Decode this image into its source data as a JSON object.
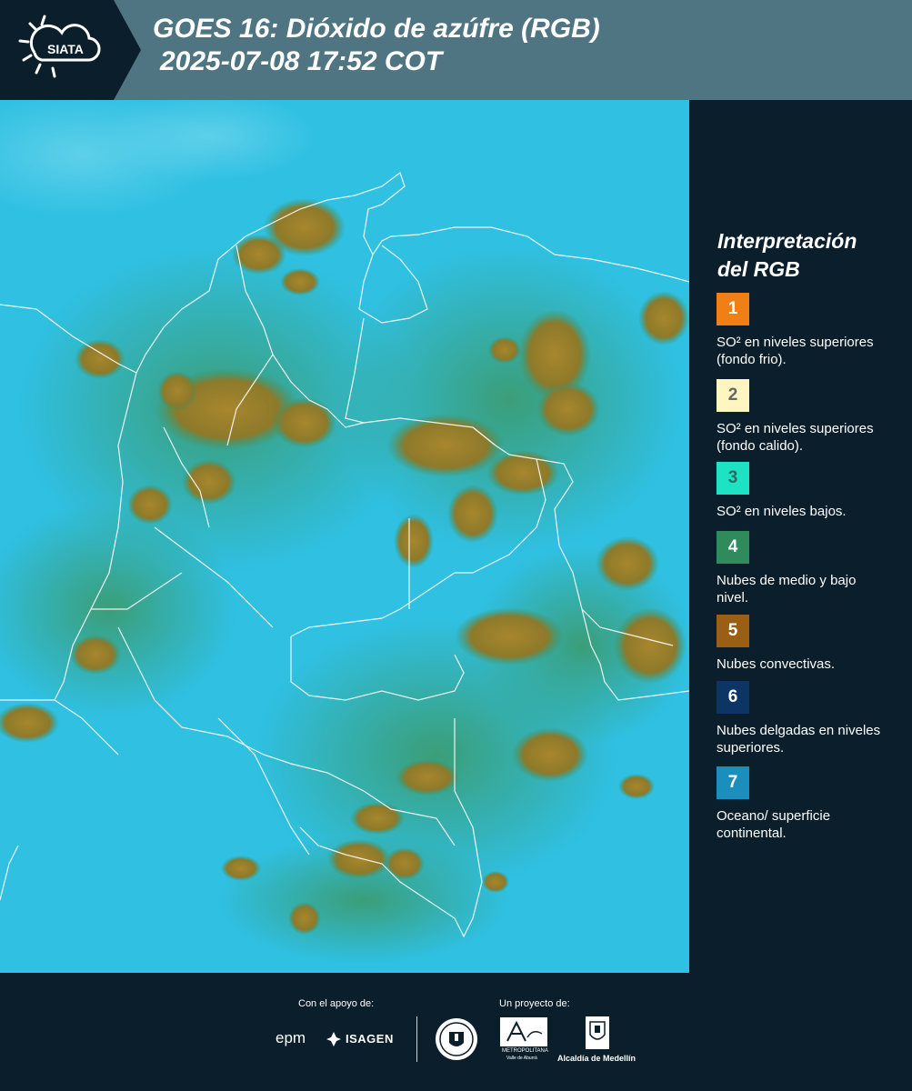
{
  "header": {
    "logo_text": "SIATA",
    "title_line1": "GOES 16: Dióxido de azúfre (RGB)",
    "title_line2": "2025-07-08 17:52 COT"
  },
  "legend": {
    "title_line1": "Interpretación",
    "title_line2": "del RGB",
    "items": [
      {
        "number": "1",
        "color": "#f07f16",
        "text": "SO² en niveles superiores (fondo frio)."
      },
      {
        "number": "2",
        "color": "#fdf6c0",
        "text": "SO² en niveles superiores (fondo calido)."
      },
      {
        "number": "3",
        "color": "#1de3c2",
        "text": "SO² en niveles bajos."
      },
      {
        "number": "4",
        "color": "#2f8a5c",
        "text": "Nubes de medio y bajo nivel."
      },
      {
        "number": "5",
        "color": "#9a5e14",
        "text": "Nubes convectivas."
      },
      {
        "number": "6",
        "color": "#0c3565",
        "text": "Nubes delgadas en niveles superiores."
      },
      {
        "number": "7",
        "color": "#1a8fbd",
        "text": "Oceano/ superficie continental."
      }
    ]
  },
  "footer": {
    "support_label": "Con el apoyo de:",
    "project_label": "Un proyecto de:",
    "epm": "epm",
    "isagen": "ISAGEN",
    "area_line1": "METROPOLITANA",
    "area_line2": "Valle de Aburrá",
    "alcaldia": "Alcaldía de Medellín"
  },
  "colors": {
    "header_bg": "#4f7482",
    "panel_bg": "#0b1e2b",
    "map_bg": "#2fc0e2",
    "cloud_convective": "#9a7a28",
    "cloud_low": "#3a9a6a"
  }
}
